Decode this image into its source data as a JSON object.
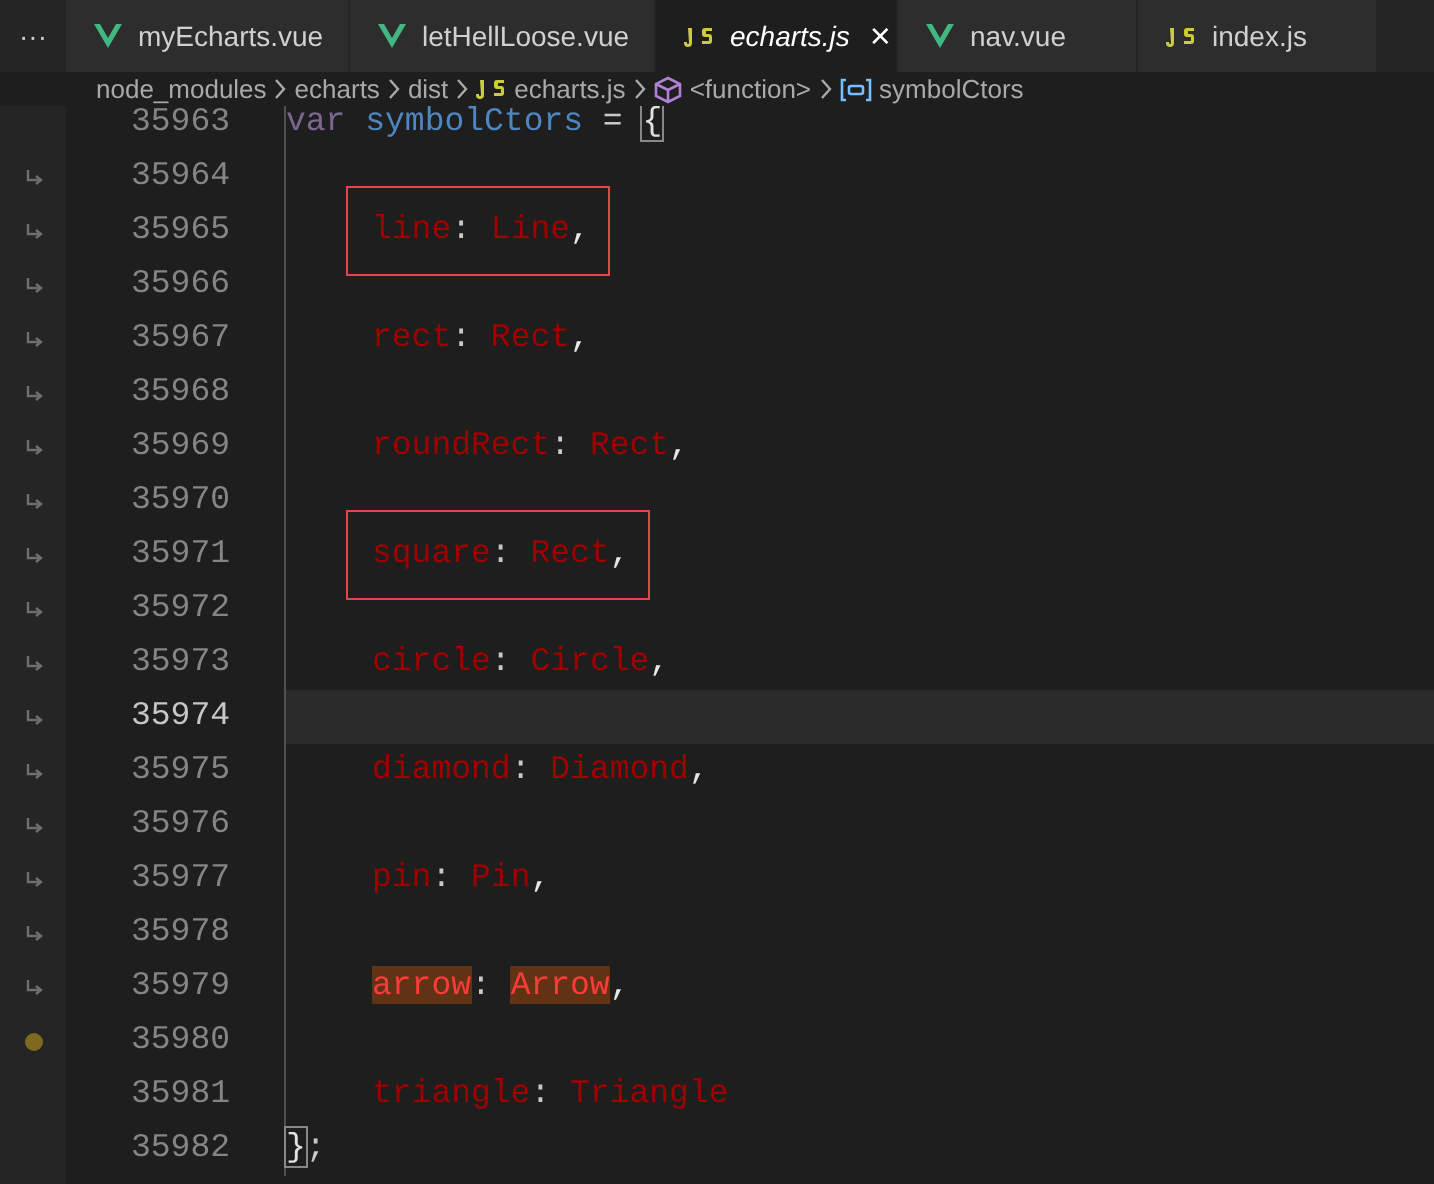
{
  "overflow_menu": "···",
  "tabs": [
    {
      "label": "myEcharts.vue",
      "kind": "vue",
      "selected": false,
      "preview": false
    },
    {
      "label": "letHellLoose.vue",
      "kind": "vue",
      "selected": false,
      "preview": false
    },
    {
      "label": "echarts.js",
      "kind": "js",
      "selected": true,
      "preview": true,
      "close": "×"
    },
    {
      "label": "nav.vue",
      "kind": "vue",
      "selected": false,
      "preview": false
    },
    {
      "label": "index.js",
      "kind": "js",
      "selected": false,
      "preview": false
    }
  ],
  "breadcrumb": [
    {
      "label": "node_modules",
      "kind": "folder"
    },
    {
      "label": "echarts",
      "kind": "folder"
    },
    {
      "label": "dist",
      "kind": "folder"
    },
    {
      "label": "echarts.js",
      "kind": "js"
    },
    {
      "label": "<function>",
      "kind": "function"
    },
    {
      "label": "symbolCtors",
      "kind": "variable"
    }
  ],
  "lines": [
    {
      "number": "35963",
      "wrapped": false,
      "breakpoint": false,
      "current": false,
      "kind": "statement",
      "tokens": [
        {
          "text": "var",
          "kind": "keyword"
        },
        {
          "text": "symbolCtors",
          "kind": "variable"
        },
        {
          "text": " = ",
          "kind": "punct"
        },
        {
          "text": "{",
          "kind": "bracket"
        }
      ]
    },
    {
      "number": "35964",
      "wrapped": true,
      "breakpoint": false,
      "current": false,
      "kind": "entry"
    },
    {
      "number": "35965",
      "wrapped": true,
      "breakpoint": false,
      "current": false,
      "kind": "entry",
      "boxed": true,
      "tokens": [
        {
          "text": "line",
          "kind": "key"
        },
        {
          "text": ": ",
          "kind": "punct"
        },
        {
          "text": "Line",
          "kind": "value"
        },
        {
          "text": ",",
          "kind": "comma"
        }
      ]
    },
    {
      "number": "35966",
      "wrapped": true,
      "breakpoint": false,
      "current": false,
      "kind": "entry"
    },
    {
      "number": "35967",
      "wrapped": true,
      "breakpoint": false,
      "current": false,
      "kind": "entry",
      "tokens": [
        {
          "text": "rect",
          "kind": "key"
        },
        {
          "text": ": ",
          "kind": "punct"
        },
        {
          "text": "Rect",
          "kind": "value"
        },
        {
          "text": ",",
          "kind": "comma"
        }
      ]
    },
    {
      "number": "35968",
      "wrapped": true,
      "breakpoint": false,
      "current": false,
      "kind": "entry"
    },
    {
      "number": "35969",
      "wrapped": true,
      "breakpoint": false,
      "current": false,
      "kind": "entry",
      "tokens": [
        {
          "text": "roundRect",
          "kind": "key"
        },
        {
          "text": ": ",
          "kind": "punct"
        },
        {
          "text": "Rect",
          "kind": "value"
        },
        {
          "text": ",",
          "kind": "comma"
        }
      ]
    },
    {
      "number": "35970",
      "wrapped": true,
      "breakpoint": false,
      "current": false,
      "kind": "entry"
    },
    {
      "number": "35971",
      "wrapped": true,
      "breakpoint": false,
      "current": false,
      "kind": "entry",
      "boxed": true,
      "tokens": [
        {
          "text": "square",
          "kind": "key"
        },
        {
          "text": ": ",
          "kind": "punct"
        },
        {
          "text": "Rect",
          "kind": "value"
        },
        {
          "text": ",",
          "kind": "comma"
        }
      ]
    },
    {
      "number": "35972",
      "wrapped": true,
      "breakpoint": false,
      "current": false,
      "kind": "entry"
    },
    {
      "number": "35973",
      "wrapped": true,
      "breakpoint": false,
      "current": false,
      "kind": "entry",
      "tokens": [
        {
          "text": "circle",
          "kind": "key"
        },
        {
          "text": ": ",
          "kind": "punct"
        },
        {
          "text": "Circle",
          "kind": "value"
        },
        {
          "text": ",",
          "kind": "comma"
        }
      ]
    },
    {
      "number": "35974",
      "wrapped": true,
      "breakpoint": false,
      "current": true,
      "kind": "entry"
    },
    {
      "number": "35975",
      "wrapped": true,
      "breakpoint": false,
      "current": false,
      "kind": "entry",
      "tokens": [
        {
          "text": "diamond",
          "kind": "key"
        },
        {
          "text": ": ",
          "kind": "punct"
        },
        {
          "text": "Diamond",
          "kind": "value"
        },
        {
          "text": ",",
          "kind": "comma"
        }
      ]
    },
    {
      "number": "35976",
      "wrapped": true,
      "breakpoint": false,
      "current": false,
      "kind": "entry"
    },
    {
      "number": "35977",
      "wrapped": true,
      "breakpoint": false,
      "current": false,
      "kind": "entry",
      "tokens": [
        {
          "text": "pin",
          "kind": "key"
        },
        {
          "text": ": ",
          "kind": "punct"
        },
        {
          "text": "Pin",
          "kind": "value"
        },
        {
          "text": ",",
          "kind": "comma"
        }
      ]
    },
    {
      "number": "35978",
      "wrapped": true,
      "breakpoint": false,
      "current": false,
      "kind": "entry"
    },
    {
      "number": "35979",
      "wrapped": true,
      "breakpoint": false,
      "current": false,
      "kind": "entry",
      "tokens": [
        {
          "text": "arrow",
          "kind": "key",
          "match": true
        },
        {
          "text": ": ",
          "kind": "punct"
        },
        {
          "text": "Arrow",
          "kind": "value",
          "match": true
        },
        {
          "text": ",",
          "kind": "comma"
        }
      ]
    },
    {
      "number": "35980",
      "wrapped": false,
      "breakpoint": true,
      "current": false,
      "kind": "entry"
    },
    {
      "number": "35981",
      "wrapped": false,
      "breakpoint": false,
      "current": false,
      "kind": "entry",
      "tokens": [
        {
          "text": "triangle",
          "kind": "key"
        },
        {
          "text": ": ",
          "kind": "punct"
        },
        {
          "text": "Triangle",
          "kind": "value"
        }
      ]
    },
    {
      "number": "35982",
      "wrapped": false,
      "breakpoint": false,
      "current": false,
      "kind": "statement",
      "tokens": [
        {
          "text": "}",
          "kind": "bracket"
        },
        {
          "text": ";",
          "kind": "punct"
        }
      ]
    }
  ]
}
